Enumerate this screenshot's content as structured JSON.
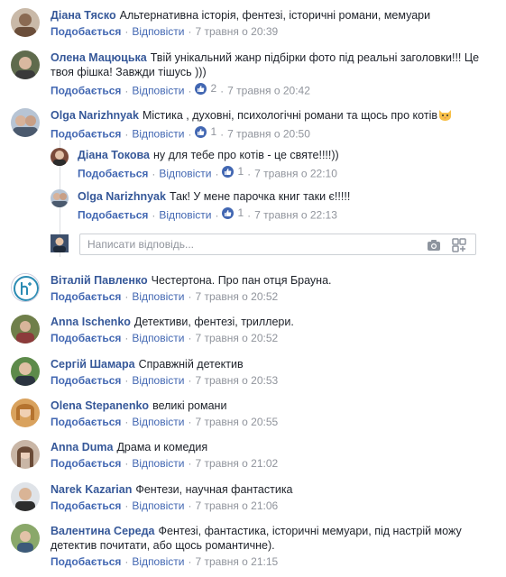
{
  "labels": {
    "like": "Подобається",
    "reply": "Відповісти",
    "sep": "·"
  },
  "comments": [
    {
      "author": "Діана Тяско",
      "text": "Альтернативна історія, фентезі, історичні романи, мемуари",
      "time": "7 травня о 20:39"
    },
    {
      "author": "Олена Мацюцька",
      "text": "Твій унікальний жанр підбірки фото під реальні заголовки!!! Це твоя фішка! Завжди тішусь )))",
      "likes": "2",
      "time": "7 травня о 20:42"
    },
    {
      "author": "Olga Narizhnyak",
      "text": "Містика , духовні, психологічні романи та щось про котів",
      "emoji": "cat-face",
      "likes": "1",
      "time": "7 травня о 20:50"
    },
    {
      "author": "Віталій Павленко",
      "text": "Честертона. Про пан отця Брауна.",
      "time": "7 травня о 20:52"
    },
    {
      "author": "Anna Ischenko",
      "text": "Детективи, фентезі, триллери.",
      "time": "7 травня о 20:52"
    },
    {
      "author": "Сергій Шамара",
      "text": "Справжній детектив",
      "time": "7 травня о 20:53"
    },
    {
      "author": "Olena Stepanenko",
      "text": "великі романи",
      "time": "7 травня о 20:55"
    },
    {
      "author": "Anna Duma",
      "text": "Драма и комедия",
      "time": "7 травня о 21:02"
    },
    {
      "author": "Narek Kazarian",
      "text": "Фентези, научная фантастика",
      "time": "7 травня о 21:06"
    },
    {
      "author": "Валентина Середа",
      "text": "Фентезі, фантастика, історичні мемуари, під настрій можу детектив почитати, або щось романтичне).",
      "time": "7 травня о 21:15"
    }
  ],
  "replies": [
    {
      "author": "Діана Токова",
      "text": "ну для тебе про котів - це святе!!!!))",
      "likes": "1",
      "time": "7 травня о 22:10"
    },
    {
      "author": "Olga Narizhnyak",
      "text": "Так! У мене парочка книг таки є!!!!!",
      "likes": "1",
      "time": "7 травня о 22:13"
    }
  ],
  "reply_box": {
    "placeholder": "Написати відповідь..."
  },
  "colors": {
    "link": "#365899",
    "action": "#4267b2",
    "meta": "#90949c",
    "border": "#dddfe2"
  }
}
